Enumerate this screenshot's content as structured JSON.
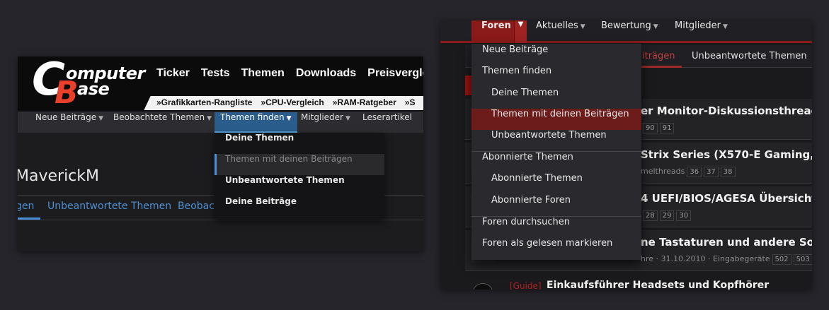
{
  "left": {
    "logo": {
      "letter_c": "C",
      "text1": "omputer",
      "letter_b": "B",
      "text2": "ase"
    },
    "main_nav": [
      "Ticker",
      "Tests",
      "Themen",
      "Downloads",
      "Preisvergle"
    ],
    "sub_nav": [
      "»Grafikkarten-Rangliste",
      "»CPU-Vergleich",
      "»RAM-Ratgeber",
      "»S"
    ],
    "forum_nav": [
      "Neue Beiträge",
      "Beobachtete Themen",
      "Themen finden",
      "Mitglieder",
      "Leserartikel"
    ],
    "forum_nav_active": "Themen finden",
    "dropdown": [
      "Deine Themen",
      "Themen mit deinen Beiträgen",
      "Unbeantwortete Themen",
      "Deine Beiträge"
    ],
    "dropdown_selected": "Themen mit deinen Beiträgen",
    "page_title": "MaverickM",
    "tabs": [
      "gen",
      "Unbeantwortete Themen",
      "Beobachi"
    ]
  },
  "right": {
    "top_nav": [
      "Foren",
      "Aktuelles",
      "Bewertung",
      "Mitglieder"
    ],
    "sub_tabs": [
      "eiträgen",
      "Unbeantwortete Themen"
    ],
    "dropdown": {
      "neue_beitraege": "Neue Beiträge",
      "themen_finden": "Themen finden",
      "deine_themen": "Deine Themen",
      "themen_mit_beitraegen": "Themen mit deinen Beiträgen",
      "unbeantwortete": "Unbeantwortete Themen",
      "abonnierte_themen_header": "Abonnierte Themen",
      "abonnierte_themen": "Abonnierte Themen",
      "abonnierte_foren": "Abonnierte Foren",
      "foren_durchsuchen": "Foren durchsuchen",
      "als_gelesen": "Foren als gelesen markieren"
    },
    "threads": [
      {
        "title": "er Monitor-Diskussionsthread (IP",
        "meta": "",
        "pages": [
          "90",
          "91"
        ]
      },
      {
        "title": "Strix Series (X570-E Gaming, X570-",
        "meta": "melthreads",
        "pages": [
          "36",
          "37",
          "38"
        ]
      },
      {
        "title": "4 UEFI/BIOS/AGESA Übersicht (0",
        "meta": "",
        "pages": [
          "28",
          "29",
          "30"
        ]
      },
      {
        "title": "ne Tastaturen und andere Sonder",
        "meta": "hre · 31.10.2010 · Eingabegeräte",
        "pages": [
          "502",
          "503",
          "504"
        ]
      }
    ],
    "last_thread": {
      "tag": "[Guide]",
      "title": "Einkaufsführer Headsets und Kopfhörer"
    }
  },
  "colors": {
    "accent_blue": "#2b5d8c",
    "accent_red": "#8b1a1a",
    "logo_orange": "#e8402a"
  }
}
